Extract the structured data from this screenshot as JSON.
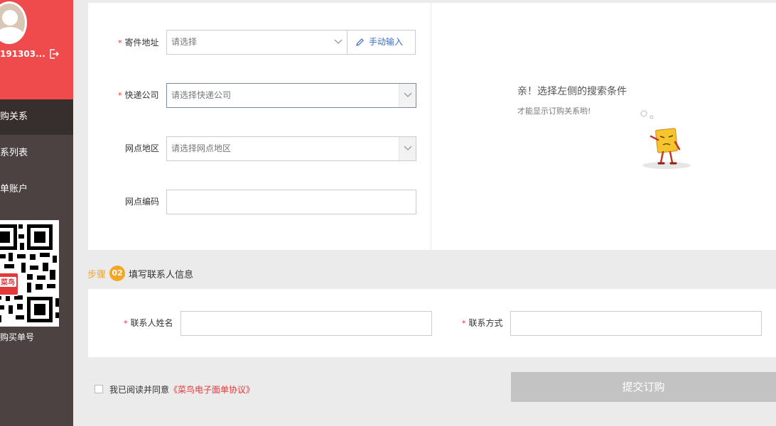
{
  "sidebar": {
    "user_name": "191303...",
    "nav_items": [
      "购关系",
      "系列表",
      "单账户"
    ],
    "qr_caption": "购买单号",
    "qr_badge": "菜鸟"
  },
  "form": {
    "sender_address": {
      "label": "寄件地址",
      "placeholder": "请选择",
      "manual_label": "手动输入"
    },
    "courier": {
      "label": "快递公司",
      "placeholder": "请选择快递公司"
    },
    "outlet_area": {
      "label": "网点地区",
      "placeholder": "请选择网点地区"
    },
    "outlet_code": {
      "label": "网点编码",
      "value": ""
    }
  },
  "empty_state": {
    "title": "亲！选择左侧的搜索条件",
    "subtitle": "才能显示订购关系哟!"
  },
  "step2": {
    "step_word": "步骤",
    "step_number": "02",
    "title": "填写联系人信息"
  },
  "contact": {
    "name": {
      "label": "联系人姓名",
      "value": ""
    },
    "phone": {
      "label": "联系方式",
      "value": ""
    }
  },
  "footer": {
    "agree_prefix": "我已阅读并同意",
    "agree_link": "《菜鸟电子面单协议》",
    "submit_label": "提交订购"
  },
  "colors": {
    "sidebar_header": "#ef4a4c",
    "sidebar_bg": "#4b4241",
    "accent_orange": "#f5a623",
    "link_red": "#e4393c",
    "link_blue": "#3a6ec7"
  }
}
